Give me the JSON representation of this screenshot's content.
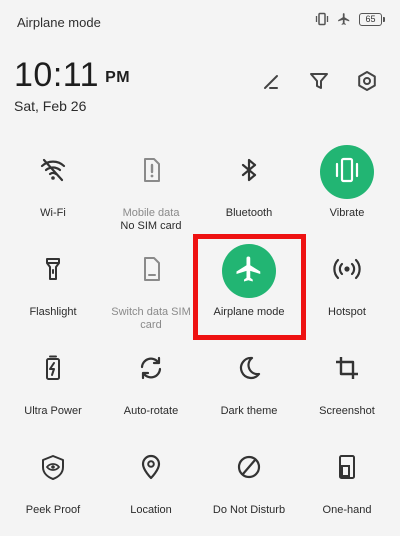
{
  "status_bar": {
    "title": "Airplane mode",
    "icons": [
      "vibrate-icon",
      "airplane-icon",
      "battery-icon"
    ],
    "battery": "65"
  },
  "header": {
    "time": "10:11",
    "ampm": "PM",
    "date": "Sat, Feb 26",
    "actions": [
      "edit-icon",
      "filter-icon",
      "settings-icon"
    ]
  },
  "tiles": [
    {
      "label": "Wi-Fi",
      "icon": "wifi-off-icon",
      "active": false
    },
    {
      "label": "Mobile data",
      "sublabel": "No SIM card",
      "icon": "sim-alert-icon",
      "active": false,
      "disabled": true
    },
    {
      "label": "Bluetooth",
      "icon": "bluetooth-icon",
      "active": false
    },
    {
      "label": "Vibrate",
      "icon": "vibrate-icon",
      "active": true
    },
    {
      "label": "Flashlight",
      "icon": "flashlight-icon",
      "active": false
    },
    {
      "label": "Switch data SIM card",
      "icon": "sim-icon",
      "active": false,
      "disabled": true
    },
    {
      "label": "Airplane mode",
      "icon": "airplane-icon",
      "active": true
    },
    {
      "label": "Hotspot",
      "icon": "hotspot-icon",
      "active": false
    },
    {
      "label": "Ultra Power",
      "icon": "battery-bolt-icon",
      "active": false
    },
    {
      "label": "Auto-rotate",
      "icon": "rotate-icon",
      "active": false
    },
    {
      "label": "Dark theme",
      "icon": "moon-icon",
      "active": false
    },
    {
      "label": "Screenshot",
      "icon": "crop-icon",
      "active": false
    },
    {
      "label": "Peek Proof",
      "icon": "eye-shield-icon",
      "active": false
    },
    {
      "label": "Location",
      "icon": "location-icon",
      "active": false
    },
    {
      "label": "Do Not Disturb",
      "icon": "dnd-icon",
      "active": false
    },
    {
      "label": "One-hand",
      "icon": "one-hand-icon",
      "active": false
    }
  ],
  "colors": {
    "active": "#22b573",
    "highlight": "#ee1111",
    "background": "#f4f4f4"
  }
}
